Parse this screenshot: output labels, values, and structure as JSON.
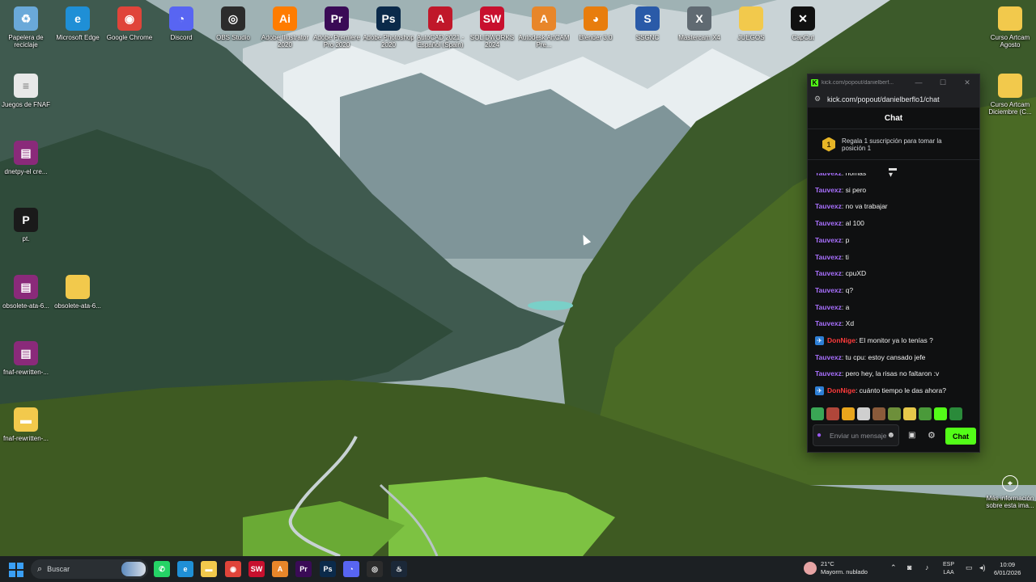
{
  "desktop": {
    "top_icons": [
      {
        "label": "Papelera de reciclaje",
        "icon": "recycle-bin-icon",
        "glyph": "♻",
        "color": "#6aa9d9"
      },
      {
        "label": "Microsoft Edge",
        "icon": "edge-icon",
        "glyph": "e",
        "color": "#1f8fd6"
      },
      {
        "label": "Google Chrome",
        "icon": "chrome-icon",
        "glyph": "◉",
        "color": "#e0443a"
      },
      {
        "label": "Discord",
        "icon": "discord-icon",
        "glyph": "◔",
        "color": "#5865f2"
      },
      {
        "label": "OBS Studio",
        "icon": "obs-icon",
        "glyph": "◎",
        "color": "#2c2c2c"
      },
      {
        "label": "Adobe Illustrator 2020",
        "icon": "illustrator-icon",
        "glyph": "Ai",
        "color": "#ff7c00"
      },
      {
        "label": "Adobe Premiere Pro 2020",
        "icon": "premiere-icon",
        "glyph": "Pr",
        "color": "#3a0b56"
      },
      {
        "label": "Adobe Photoshop 2020",
        "icon": "photoshop-icon",
        "glyph": "Ps",
        "color": "#0b2a4a"
      },
      {
        "label": "AutoCAD 2021 - Español (Spain)",
        "icon": "autocad-icon",
        "glyph": "A",
        "color": "#c0182a"
      },
      {
        "label": "SOLIDWORKS 2024",
        "icon": "solidworks-icon",
        "glyph": "SW",
        "color": "#c8102e"
      },
      {
        "label": "Autodesk ArtCAM Pre...",
        "icon": "artcam-icon",
        "glyph": "A",
        "color": "#e8862a"
      },
      {
        "label": "Blender 3.0",
        "icon": "blender-icon",
        "glyph": "◕",
        "color": "#e87d0d"
      },
      {
        "label": "SSGNC",
        "icon": "ssgnc-icon",
        "glyph": "S",
        "color": "#2a5aa8"
      },
      {
        "label": "Mastercam X4",
        "icon": "mastercam-icon",
        "glyph": "X",
        "color": "#606a72"
      },
      {
        "label": "JUEGOS",
        "icon": "folder-icon",
        "glyph": "",
        "color": "#f2c94c"
      },
      {
        "label": "CapCut",
        "icon": "capcut-icon",
        "glyph": "✕",
        "color": "#111111"
      }
    ],
    "left_icons": [
      {
        "label": "Juegos de FNAF",
        "icon": "file-icon",
        "glyph": "≡",
        "color": "#e8e8e8"
      },
      {
        "label": "dnetpy-el cre...",
        "icon": "winrar-icon",
        "glyph": "▤",
        "color": "#8a2a7a"
      },
      {
        "label": "pt.",
        "icon": "app-icon",
        "glyph": "P",
        "color": "#1a1a1a"
      },
      {
        "label": "obsolete-ata-6...",
        "icon": "winrar-icon",
        "glyph": "▤",
        "color": "#8a2a7a"
      },
      {
        "label": "obsolete-ata-6...",
        "icon": "folder-icon",
        "glyph": "",
        "color": "#f2c94c"
      },
      {
        "label": "fnaf-rewritten-...",
        "icon": "winrar-icon",
        "glyph": "▤",
        "color": "#8a2a7a"
      },
      {
        "label": "fnaf-rewritten-...",
        "icon": "folder-icon",
        "glyph": "▬",
        "color": "#f2c94c"
      }
    ],
    "right_icons": [
      {
        "label": "Curso Artcam Agosto",
        "icon": "folder-icon"
      },
      {
        "label": "Curso Artcam Diciembre (C...",
        "icon": "folder-icon"
      },
      {
        "label": "Más información sobre esta ima...",
        "icon": "info-icon"
      }
    ]
  },
  "chat_window": {
    "title": "kick.com/popout/danielberf...",
    "url": "kick.com/popout/danielberflo1/chat",
    "header": "Chat",
    "gift_badge": "1",
    "gift_text": "Regala 1 suscripción para tomar la posición 1",
    "messages": [
      {
        "user": "Tauvexz",
        "text": ": nomas",
        "color": "#a970ff",
        "badge": false
      },
      {
        "user": "Tauvexz",
        "text": ": si pero",
        "color": "#a970ff",
        "badge": false
      },
      {
        "user": "Tauvexz",
        "text": ": no va trabajar",
        "color": "#a970ff",
        "badge": false
      },
      {
        "user": "Tauvexz",
        "text": ": al 100",
        "color": "#a970ff",
        "badge": false
      },
      {
        "user": "Tauvexz",
        "text": ": p",
        "color": "#a970ff",
        "badge": false
      },
      {
        "user": "Tauvexz",
        "text": ": ti",
        "color": "#a970ff",
        "badge": false
      },
      {
        "user": "Tauvexz",
        "text": ": cpuXD",
        "color": "#a970ff",
        "badge": false
      },
      {
        "user": "Tauvexz",
        "text": ": q?",
        "color": "#a970ff",
        "badge": false
      },
      {
        "user": "Tauvexz",
        "text": ": a",
        "color": "#a970ff",
        "badge": false
      },
      {
        "user": "Tauvexz",
        "text": ": Xd",
        "color": "#a970ff",
        "badge": false
      },
      {
        "user": "DonNige",
        "text": ": El monitor ya lo tenías ?",
        "color": "#ff3b3b",
        "badge": true
      },
      {
        "user": "Tauvexz",
        "text": ": tu cpu: estoy cansado jefe",
        "color": "#a970ff",
        "badge": false
      },
      {
        "user": "Tauvexz",
        "text": ": pero hey, la risas no faltaron :v",
        "color": "#a970ff",
        "badge": false
      },
      {
        "user": "DonNige",
        "text": ": cuánto tiempo le das ahora?",
        "color": "#ff3b3b",
        "badge": true
      }
    ],
    "emotes": [
      "#3aa655",
      "#b0463a",
      "#e8a51c",
      "#cfcfcf",
      "#8a5a3a",
      "#6d8f3a",
      "#e6c84a",
      "#4a9a3a",
      "#53fc18",
      "#2a8a3a"
    ],
    "input_placeholder": "Enviar un mensaje",
    "send_label": "Chat"
  },
  "taskbar": {
    "search_label": "Buscar",
    "apps": [
      {
        "name": "whatsapp-icon",
        "glyph": "✆",
        "color": "#25d366"
      },
      {
        "name": "edge-icon",
        "glyph": "e",
        "color": "#1f8fd6"
      },
      {
        "name": "file-explorer-icon",
        "glyph": "▬",
        "color": "#f2c94c"
      },
      {
        "name": "chrome-icon",
        "glyph": "◉",
        "color": "#e0443a"
      },
      {
        "name": "solidworks-icon",
        "glyph": "SW",
        "color": "#c8102e"
      },
      {
        "name": "artcam-icon",
        "glyph": "A",
        "color": "#e8862a"
      },
      {
        "name": "premiere-icon",
        "glyph": "Pr",
        "color": "#3a0b56"
      },
      {
        "name": "photoshop-icon",
        "glyph": "Ps",
        "color": "#0b2a4a"
      },
      {
        "name": "discord-icon",
        "glyph": "◔",
        "color": "#5865f2"
      },
      {
        "name": "obs-icon",
        "glyph": "◎",
        "color": "#2c2c2c"
      },
      {
        "name": "steam-icon",
        "glyph": "♨",
        "color": "#1b2838"
      }
    ],
    "weather_temp": "21°C",
    "weather_desc": "Mayorm. nublado",
    "lang_1": "ESP",
    "lang_2": "LAA",
    "time": "10:09",
    "date": "6/01/2026"
  }
}
